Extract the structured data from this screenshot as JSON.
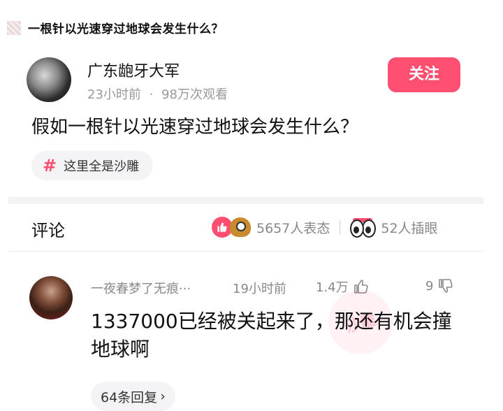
{
  "headline": "一根针以光速穿过地球会发生什么？",
  "post": {
    "author": "广东龅牙大军",
    "time": "23小时前",
    "separator": "·",
    "views": "98万次观看",
    "follow_label": "关注",
    "question": "假如一根针以光速穿过地球会发生什么？",
    "topic_symbol": "#",
    "topic": "这里全是沙雕"
  },
  "comments_section": {
    "title": "评论",
    "reactions_count": "5657人表态",
    "eyes_count": "52人插眼"
  },
  "comment": {
    "user": "一夜春梦了无痕···",
    "time": "19小时前",
    "likes": "1.4万",
    "dislikes": "9",
    "text": "1337000已经被关起来了，那还有机会撞地球啊",
    "watermark": "沙雕",
    "replies": "64条回复",
    "replies_chevron": "›"
  },
  "colors": {
    "accent": "#fe4f70",
    "muted_text": "#999999",
    "pill_bg": "#f4f4f6"
  },
  "icons": [
    "thumb-up-icon",
    "thumb-down-icon",
    "hashtag-icon",
    "like-emoji-icon",
    "eyes-emoji-icon"
  ]
}
